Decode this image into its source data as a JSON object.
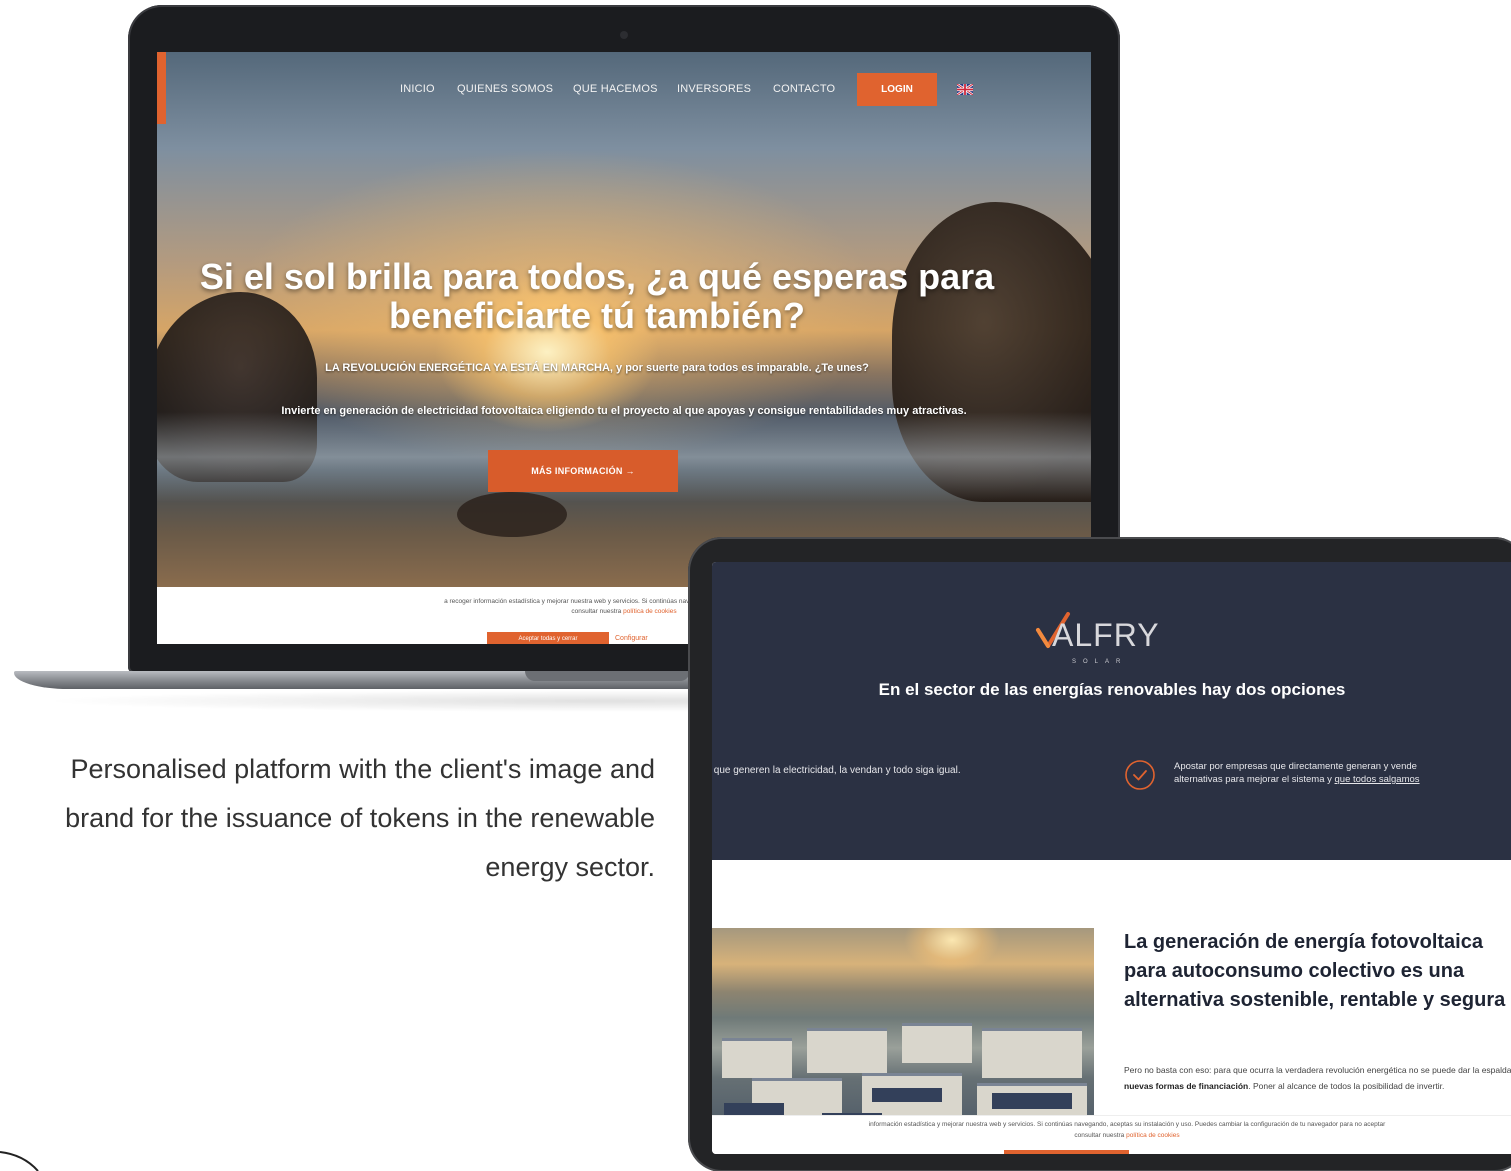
{
  "laptop": {
    "nav": {
      "items": [
        {
          "label": "INICIO"
        },
        {
          "label": "QUIENES SOMOS"
        },
        {
          "label": "QUE HACEMOS"
        },
        {
          "label": "INVERSORES"
        },
        {
          "label": "CONTACTO"
        }
      ],
      "login_label": "LOGIN",
      "language_icon": "uk-flag-icon"
    },
    "hero": {
      "title": "Si el sol brilla para todos, ¿a qué esperas para beneficiarte tú también?",
      "subtitle": "LA REVOLUCIÓN ENERGÉTICA YA ESTÁ EN MARCHA, y por suerte para todos es imparable. ¿Te unes?",
      "description": "Invierte en generación de electricidad fotovoltaica eligiendo tu el proyecto al que apoyas y consigue rentabilidades muy atractivas.",
      "cta_label": "MÁS INFORMACIÓN →"
    },
    "cookie": {
      "line1": "a recoger información estadística y mejorar nuestra web y servicios. Si continúas navegando, aceptas su instalación y uso. P",
      "line2_prefix": "consultar nuestra ",
      "line2_link": "política de cookies",
      "accept_label": "Aceptar todas y cerrar",
      "config_label": "Configurar"
    }
  },
  "caption": {
    "text": "Personalised platform with the client's image and brand for the issuance of tokens in the renewable energy sector."
  },
  "tablet": {
    "logo": {
      "text": "ALFRY",
      "sub": "SOLAR"
    },
    "heading": "En el sector de las energías renovables hay dos opciones",
    "option_left": "s que generen la electricidad, la vendan y todo siga igual.",
    "option_right_line1": "Apostar por empresas que directamente generan y vende",
    "option_right_line2_prefix": "alternativas para mejorar el sistema y ",
    "option_right_line2_link": "que todos salgamos",
    "article": {
      "title": "La generación de energía fotovoltaica para autoconsumo colectivo es una alternativa sostenible, rentable y segura",
      "body_prefix": "Pero no basta con eso: para que ocurra la verdadera revolución energética no se puede dar la espalda a ",
      "body_bold": "las nuevas formas de financiación",
      "body_suffix": ". Poner al alcance de todos la posibilidad de invertir."
    },
    "cookie": {
      "line1": "información estadística y mejorar nuestra web y servicios. Si continúas navegando, aceptas su instalación y uso. Puedes cambiar la configuración de tu navegador para no aceptar",
      "line2_prefix": "consultar nuestra ",
      "line2_link": "política de cookies"
    }
  },
  "colors": {
    "accent": "#e0632f",
    "tablet_dark": "#2b3143",
    "caption_text": "#333333"
  }
}
